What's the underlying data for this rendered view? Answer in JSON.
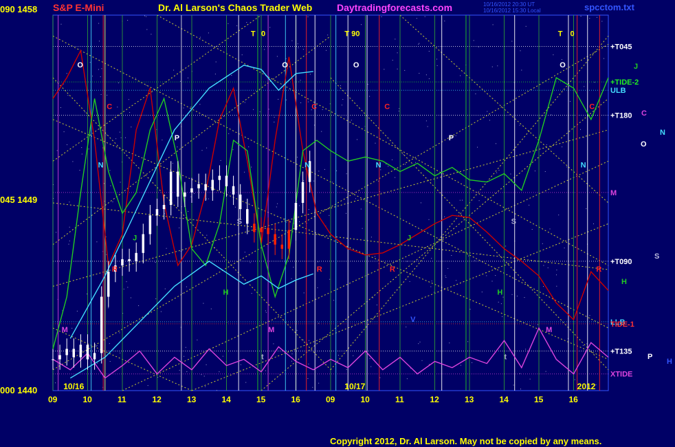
{
  "header": {
    "instrument": "S&P E-Mini",
    "site_title": "Dr. Al Larson's Chaos Trader Web",
    "site_url": "Daytradingforecasts.com",
    "stamp_line1": "10/16/2012 20:30 UT",
    "stamp_line2": "10/16/2012 15:30 Local",
    "data_file": "spcctom.txt"
  },
  "price_axis": {
    "top": "090  1458",
    "middle": "045  1449",
    "bottom": "000  1440"
  },
  "footer": {
    "copyright": "Copyright 2012, Dr. Al Larson. May not be copied by any means."
  },
  "colors": {
    "background": "#000066",
    "price_bars": "#ffffff",
    "price_bars_down": "#ff2200",
    "tide_red": "#cc0000",
    "tide_green": "#22cc22",
    "band_cyan": "#44ddff",
    "xtide_magenta": "#dd44dd",
    "gann_yellow": "#dddd44",
    "text_yellow": "#ffff00"
  },
  "chart_data": {
    "type": "line",
    "title": "S&P E-Mini",
    "ylim": [
      1440,
      1458
    ],
    "y_ticks": [
      {
        "label": "090  1458",
        "value": 1458
      },
      {
        "label": "045  1449",
        "value": 1449
      },
      {
        "label": "000  1440",
        "value": 1440
      }
    ],
    "x_hours": [
      {
        "label": "09",
        "t": 0.5
      },
      {
        "label": "10",
        "t": 1.5
      },
      {
        "label": "11",
        "t": 2.5
      },
      {
        "label": "12",
        "t": 3.5
      },
      {
        "label": "13",
        "t": 4.5
      },
      {
        "label": "14",
        "t": 5.5
      },
      {
        "label": "15",
        "t": 6.5
      },
      {
        "label": "16",
        "t": 7.5
      },
      {
        "label": "09",
        "t": 8.5
      },
      {
        "label": "10",
        "t": 9.5
      },
      {
        "label": "11",
        "t": 10.5
      },
      {
        "label": "12",
        "t": 11.5
      },
      {
        "label": "13",
        "t": 12.5
      },
      {
        "label": "14",
        "t": 13.5
      },
      {
        "label": "15",
        "t": 14.5
      },
      {
        "label": "16",
        "t": 15.5
      }
    ],
    "date_labels": [
      {
        "label": "10/16",
        "t": 0.5
      },
      {
        "label": "10/17",
        "t": 8.6
      },
      {
        "label": "2012",
        "t": 15.3
      }
    ],
    "price_series": {
      "name": "S&P E-Mini",
      "t": [
        0.0,
        0.2,
        0.4,
        0.6,
        0.8,
        1.0,
        1.2,
        1.4,
        1.6,
        1.8,
        2.0,
        2.2,
        2.4,
        2.6,
        2.8,
        3.0,
        3.2,
        3.4,
        3.6,
        3.8,
        4.0,
        4.2,
        4.4,
        4.6,
        4.8,
        5.0,
        5.2,
        5.4,
        5.6,
        5.8,
        6.0,
        6.2,
        6.4,
        6.6,
        6.8,
        7.0,
        7.2,
        7.4
      ],
      "close": [
        1441.5,
        1441.7,
        1442.0,
        1441.6,
        1442.2,
        1441.5,
        1441.8,
        1444.5,
        1445.7,
        1446.0,
        1446.3,
        1446.2,
        1446.6,
        1447.5,
        1448.4,
        1448.7,
        1448.9,
        1450.5,
        1449.3,
        1449.5,
        1449.7,
        1449.9,
        1449.6,
        1450.1,
        1450.3,
        1449.8,
        1449.4,
        1448.7,
        1448.0,
        1447.6,
        1447.8,
        1447.5,
        1447.0,
        1446.8,
        1447.7,
        1449.0,
        1450.0,
        1451.0
      ]
    },
    "series": [
      {
        "name": "TIDE-1",
        "color": "#cc0000",
        "t": [
          0,
          0.4,
          0.8,
          1.2,
          1.6,
          2.0,
          2.4,
          2.8,
          3.2,
          3.6,
          4.0,
          4.4,
          4.8,
          5.2,
          5.6,
          6.0,
          6.4,
          6.8,
          7.2,
          7.6,
          8.0,
          8.5,
          9.0,
          9.5,
          10.0,
          10.5,
          11.0,
          11.5,
          12.0,
          12.5,
          13.0,
          13.5,
          14.0,
          14.5,
          15.0,
          15.5,
          16.0
        ],
        "values": [
          1454.0,
          1455.0,
          1456.3,
          1452.0,
          1446.0,
          1447.5,
          1452.5,
          1454.5,
          1449.0,
          1446.0,
          1447.0,
          1449.5,
          1453.0,
          1454.5,
          1451.0,
          1447.0,
          1452.0,
          1456.0,
          1451.5,
          1448.5,
          1447.5,
          1446.8,
          1446.5,
          1446.6,
          1447.0,
          1447.5,
          1448.0,
          1448.4,
          1448.3,
          1447.6,
          1446.8,
          1446.2,
          1445.5,
          1444.2,
          1443.4,
          1445.7,
          1444.8
        ]
      },
      {
        "name": "TIDE-2",
        "color": "#22cc22",
        "t": [
          0,
          0.4,
          0.8,
          1.2,
          1.6,
          2.0,
          2.4,
          2.8,
          3.2,
          3.6,
          4.0,
          4.4,
          4.8,
          5.2,
          5.6,
          6.0,
          6.4,
          6.8,
          7.2,
          7.6,
          8.0,
          8.5,
          9.0,
          9.5,
          10.0,
          10.5,
          11.0,
          11.5,
          12.0,
          12.5,
          13.0,
          13.5,
          14.0,
          14.5,
          15.0,
          15.5,
          16.0
        ],
        "values": [
          1442.0,
          1444.5,
          1449.5,
          1454.0,
          1450.5,
          1448.5,
          1449.5,
          1452.5,
          1454.0,
          1451.0,
          1446.8,
          1446.0,
          1448.0,
          1452.0,
          1451.5,
          1447.0,
          1444.5,
          1446.5,
          1451.5,
          1452.0,
          1451.5,
          1451.0,
          1451.2,
          1451.0,
          1450.5,
          1450.9,
          1450.3,
          1450.7,
          1450.1,
          1450.0,
          1450.4,
          1449.6,
          1452.0,
          1455.0,
          1454.5,
          1453.0,
          1455.0
        ]
      },
      {
        "name": "ULB",
        "color": "#44ddff",
        "t": [
          0.5,
          1.5,
          2.5,
          3.5,
          4.5,
          5.5,
          6.0,
          6.5,
          7.0,
          7.5
        ],
        "values": [
          1442.5,
          1445.5,
          1449.0,
          1452.5,
          1454.5,
          1455.6,
          1455.4,
          1454.4,
          1455.2,
          1455.3
        ]
      },
      {
        "name": "LLB",
        "color": "#44ddff",
        "t": [
          0.5,
          1.5,
          2.5,
          3.5,
          4.5,
          5.5,
          6.0,
          6.5,
          7.0,
          7.5
        ],
        "values": [
          1440.6,
          1441.6,
          1443.3,
          1445.0,
          1446.2,
          1445.1,
          1445.5,
          1444.9,
          1445.3,
          1445.6
        ]
      },
      {
        "name": "XTIDE",
        "color": "#dd44dd",
        "t": [
          0,
          0.5,
          1.0,
          1.5,
          2.0,
          2.5,
          3.0,
          3.5,
          4.0,
          4.5,
          5.0,
          5.5,
          6.0,
          6.5,
          7.0,
          7.5,
          8.0,
          8.5,
          9.0,
          9.5,
          10.0,
          10.5,
          11.0,
          11.5,
          12.0,
          12.5,
          13.0,
          13.5,
          14.0,
          14.5,
          15.0,
          15.5,
          16.0
        ],
        "values": [
          1441.5,
          1441.0,
          1441.8,
          1440.6,
          1441.2,
          1441.9,
          1440.8,
          1441.6,
          1441.0,
          1442.0,
          1441.2,
          1441.5,
          1440.9,
          1442.1,
          1441.4,
          1441.0,
          1441.5,
          1441.1,
          1441.9,
          1441.0,
          1441.6,
          1440.8,
          1441.4,
          1441.1,
          1441.6,
          1441.3,
          1442.4,
          1441.1,
          1443.0,
          1441.5,
          1440.8,
          1442.3,
          1441.6
        ]
      }
    ],
    "horizontal_levels": [
      {
        "label": "+T045",
        "value": 1456.5,
        "color": "#ffffff"
      },
      {
        "label": "+TIDE-2",
        "value": 1454.8,
        "color": "#22ee22"
      },
      {
        "label": "ULB",
        "value": 1454.4,
        "color": "#44ddff"
      },
      {
        "label": "+T180",
        "value": 1453.2,
        "color": "#ffffff"
      },
      {
        "label": "M",
        "value": 1449.5,
        "color": "#dd44dd"
      },
      {
        "label": "+T090",
        "value": 1446.2,
        "color": "#ffffff"
      },
      {
        "label": "LLB",
        "value": 1443.3,
        "color": "#44ddff"
      },
      {
        "label": "TIDE-1",
        "value": 1443.2,
        "color": "#ff3333"
      },
      {
        "label": "+T135",
        "value": 1441.9,
        "color": "#ffffff"
      },
      {
        "label": "XTIDE",
        "value": 1440.8,
        "color": "#dd44dd"
      }
    ],
    "planet_glyphs": [
      {
        "glyph": "J",
        "color": "#22cc22"
      },
      {
        "glyph": "C",
        "color": "#dd44dd"
      },
      {
        "glyph": "N",
        "color": "#44ddff"
      },
      {
        "glyph": "O",
        "color": "#ffffff"
      },
      {
        "glyph": "S",
        "color": "#bbbbdd"
      },
      {
        "glyph": "H",
        "color": "#22cc22"
      },
      {
        "glyph": "P",
        "color": "#ffffff"
      },
      {
        "glyph": "H",
        "color": "#3355ff"
      }
    ],
    "time_markers": [
      {
        "label": "O",
        "t": 0.7,
        "value": 1455.5,
        "color": "#ffffff"
      },
      {
        "label": "O",
        "t": 6.6,
        "value": 1455.5,
        "color": "#ffffff"
      },
      {
        "label": "O",
        "t": 8.65,
        "value": 1455.5,
        "color": "#ffffff"
      },
      {
        "label": "O",
        "t": 14.6,
        "value": 1455.5,
        "color": "#ffffff"
      },
      {
        "label": "C",
        "t": 1.55,
        "value": 1453.5,
        "color": "#ff2222"
      },
      {
        "label": "C",
        "t": 7.45,
        "value": 1453.5,
        "color": "#ff2222"
      },
      {
        "label": "C",
        "t": 9.55,
        "value": 1453.5,
        "color": "#ff2222"
      },
      {
        "label": "C",
        "t": 15.45,
        "value": 1453.5,
        "color": "#ff2222"
      },
      {
        "label": "N",
        "t": 1.3,
        "value": 1450.7,
        "color": "#44ddff"
      },
      {
        "label": "N",
        "t": 7.25,
        "value": 1450.7,
        "color": "#44ddff"
      },
      {
        "label": "N",
        "t": 9.3,
        "value": 1450.7,
        "color": "#44ddff"
      },
      {
        "label": "N",
        "t": 15.2,
        "value": 1450.7,
        "color": "#44ddff"
      },
      {
        "label": "P",
        "t": 3.5,
        "value": 1452.0,
        "color": "#ffffff"
      },
      {
        "label": "P",
        "t": 11.4,
        "value": 1452.0,
        "color": "#ffffff"
      },
      {
        "label": "S",
        "t": 5.3,
        "value": 1448.0,
        "color": "#aaaacc"
      },
      {
        "label": "S",
        "t": 13.2,
        "value": 1448.0,
        "color": "#aaaacc"
      },
      {
        "label": "R",
        "t": 1.7,
        "value": 1445.7,
        "color": "#ff2222"
      },
      {
        "label": "R",
        "t": 7.6,
        "value": 1445.7,
        "color": "#ff2222"
      },
      {
        "label": "R",
        "t": 9.7,
        "value": 1445.7,
        "color": "#ff2222"
      },
      {
        "label": "R",
        "t": 15.65,
        "value": 1445.7,
        "color": "#ff2222"
      },
      {
        "label": "H",
        "t": 4.9,
        "value": 1444.6,
        "color": "#22cc22"
      },
      {
        "label": "H",
        "t": 12.8,
        "value": 1444.6,
        "color": "#22cc22"
      },
      {
        "label": "J",
        "t": 2.3,
        "value": 1447.2,
        "color": "#22cc22"
      },
      {
        "label": "J",
        "t": 10.2,
        "value": 1447.2,
        "color": "#22cc22"
      },
      {
        "label": "M",
        "t": 0.25,
        "value": 1442.8,
        "color": "#dd44dd"
      },
      {
        "label": "M",
        "t": 6.2,
        "value": 1442.8,
        "color": "#dd44dd"
      },
      {
        "label": "M",
        "t": 14.2,
        "value": 1442.8,
        "color": "#dd44dd"
      },
      {
        "label": "V",
        "t": 10.3,
        "value": 1443.3,
        "color": "#3355ff"
      },
      {
        "label": "T",
        "t": 5.7,
        "value": 1457.0,
        "color": "#ffff00"
      },
      {
        "label": "0",
        "t": 6.0,
        "value": 1457.0,
        "color": "#ffff00"
      },
      {
        "label": "T",
        "t": 8.4,
        "value": 1457.0,
        "color": "#ffff00"
      },
      {
        "label": "90",
        "t": 8.6,
        "value": 1457.0,
        "color": "#ffff00"
      },
      {
        "label": "T",
        "t": 14.55,
        "value": 1457.0,
        "color": "#ffff00"
      },
      {
        "label": "0",
        "t": 14.9,
        "value": 1457.0,
        "color": "#ffff00"
      },
      {
        "label": "t",
        "t": 6.0,
        "value": 1441.5,
        "color": "#aaaacc"
      },
      {
        "label": "t",
        "t": 13.0,
        "value": 1441.5,
        "color": "#aaaacc"
      }
    ]
  }
}
